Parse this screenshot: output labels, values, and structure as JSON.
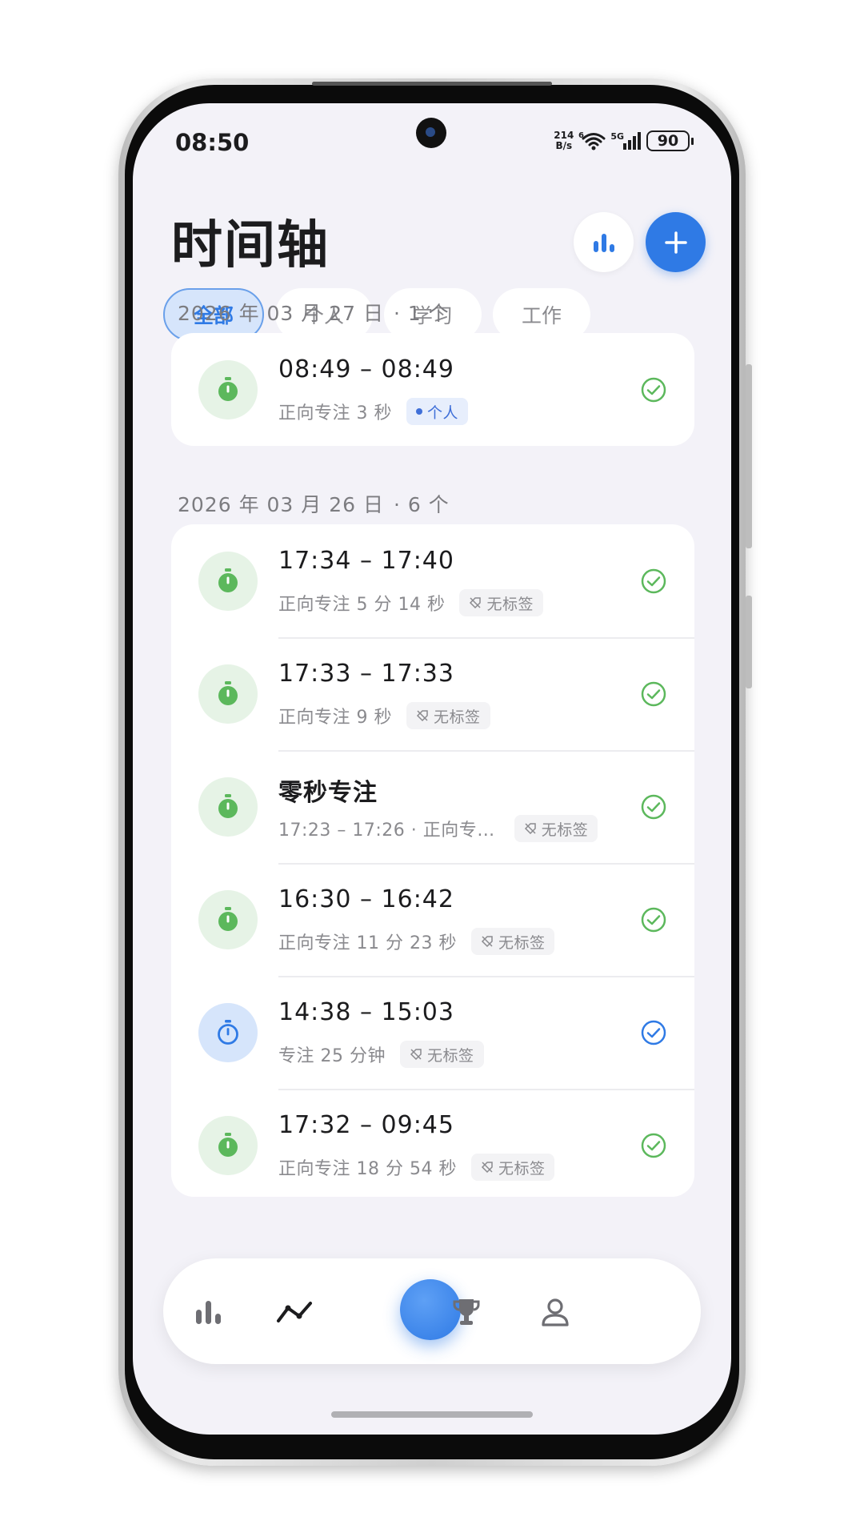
{
  "status_bar": {
    "time": "08:50",
    "net_speed_top": "214",
    "net_speed_bottom": "B/s",
    "wifi_badge": "6",
    "signal_label": "5G",
    "battery": "90"
  },
  "header": {
    "title": "时间轴"
  },
  "filters": [
    {
      "label": "全部",
      "active": true
    },
    {
      "label": "个人",
      "active": false
    },
    {
      "label": "学习",
      "active": false
    },
    {
      "label": "工作",
      "active": false
    }
  ],
  "sections": [
    {
      "date": "2026 年 03 月 27 日",
      "count": "· 1 个",
      "items": [
        {
          "title": "08:49 – 08:49",
          "subtitle": "正向专注 3 秒",
          "tag": "个人",
          "tag_type": "personal",
          "mode": "stopwatch",
          "color": "#5cb85c"
        }
      ]
    },
    {
      "date": "2026 年 03 月 26 日",
      "count": "· 6 个",
      "items": [
        {
          "title": "17:34 – 17:40",
          "subtitle": "正向专注 5 分 14 秒",
          "tag": "无标签",
          "tag_type": "none",
          "mode": "stopwatch",
          "color": "#5cb85c"
        },
        {
          "title": "17:33 – 17:33",
          "subtitle": "正向专注 9 秒",
          "tag": "无标签",
          "tag_type": "none",
          "mode": "stopwatch",
          "color": "#5cb85c"
        },
        {
          "title": "零秒专注",
          "subtitle": "17:23 – 17:26 · 正向专…",
          "tag": "无标签",
          "tag_type": "none",
          "mode": "stopwatch",
          "color": "#5cb85c"
        },
        {
          "title": "16:30 – 16:42",
          "subtitle": "正向专注 11 分 23 秒",
          "tag": "无标签",
          "tag_type": "none",
          "mode": "stopwatch",
          "color": "#5cb85c"
        },
        {
          "title": "14:38 – 15:03",
          "subtitle": "专注 25 分钟",
          "tag": "无标签",
          "tag_type": "none",
          "mode": "timer",
          "color": "#2f7ae5"
        },
        {
          "title": "17:32 – 09:45",
          "subtitle": "正向专注 18 分 54 秒",
          "tag": "无标签",
          "tag_type": "none",
          "mode": "stopwatch",
          "color": "#5cb85c"
        }
      ]
    }
  ],
  "bottom_nav": [
    {
      "icon": "bar-chart-icon"
    },
    {
      "icon": "timeline-icon",
      "active": true
    },
    {
      "icon": "focus-start-button"
    },
    {
      "icon": "trophy-icon"
    },
    {
      "icon": "profile-icon"
    }
  ],
  "colors": {
    "accent": "#2f7ae5",
    "success": "#5cb85c",
    "background": "#f3f2f8"
  }
}
